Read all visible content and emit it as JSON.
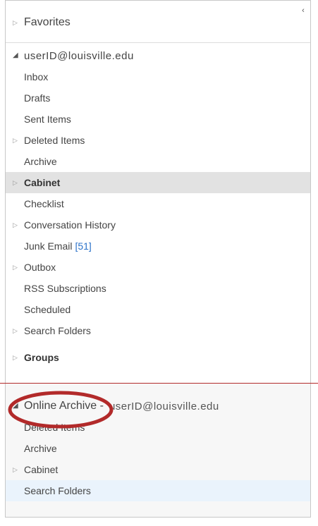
{
  "pane": {
    "collapse_glyph": "‹",
    "favorites": {
      "label": "Favorites",
      "state": "collapsed"
    },
    "account": {
      "label": "userID@louisville.edu",
      "state": "expanded"
    },
    "folders": [
      {
        "label": "Inbox",
        "expandable": false
      },
      {
        "label": "Drafts",
        "expandable": false
      },
      {
        "label": "Sent Items",
        "expandable": false
      },
      {
        "label": "Deleted Items",
        "expandable": true
      },
      {
        "label": "Archive",
        "expandable": false
      },
      {
        "label": "Cabinet",
        "expandable": true,
        "selected": true,
        "bold": true
      },
      {
        "label": "Checklist",
        "expandable": false
      },
      {
        "label": "Conversation History",
        "expandable": true
      },
      {
        "label": "Junk Email",
        "expandable": false,
        "count": "[51]"
      },
      {
        "label": "Outbox",
        "expandable": true
      },
      {
        "label": "RSS Subscriptions",
        "expandable": false
      },
      {
        "label": "Scheduled",
        "expandable": false
      },
      {
        "label": "Search Folders",
        "expandable": true
      }
    ],
    "groups": {
      "label": "Groups",
      "state": "collapsed"
    },
    "online_archive": {
      "prefix": "Online Archive -",
      "account": "userID@louisville.edu",
      "state": "expanded",
      "folders": [
        {
          "label": "Deleted Items",
          "expandable": false
        },
        {
          "label": "Archive",
          "expandable": false
        },
        {
          "label": "Cabinet",
          "expandable": true
        },
        {
          "label": "Search Folders",
          "expandable": false,
          "highlighted": true
        }
      ]
    }
  },
  "colors": {
    "count_blue": "#2b72c9",
    "selected_bg": "#e2e2e2",
    "hover_bg": "#eaf3fc",
    "annotation_red": "#b22a2a"
  }
}
